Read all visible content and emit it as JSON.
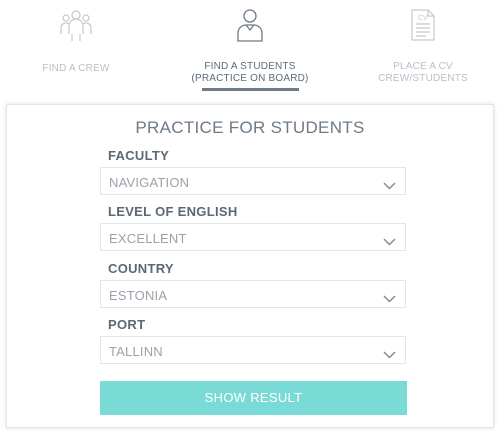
{
  "tabs": [
    {
      "label_line1": "FIND A CREW",
      "label_line2": "",
      "icon": "crew-group-icon",
      "active": false
    },
    {
      "label_line1": "FIND A STUDENTS",
      "label_line2": "(PRACTICE ON BOARD)",
      "icon": "student-person-icon",
      "active": true
    },
    {
      "label_line1": "PLACE A CV",
      "label_line2": "CREW/STUDENTS",
      "icon": "cv-document-icon",
      "active": false
    }
  ],
  "cv_icon_text": "CV",
  "form": {
    "title": "PRACTICE FOR STUDENTS",
    "fields": [
      {
        "label": "FACULTY",
        "value": "NAVIGATION"
      },
      {
        "label": "LEVEL OF ENGLISH",
        "value": "EXCELLENT"
      },
      {
        "label": "COUNTRY",
        "value": "ESTONIA"
      },
      {
        "label": "PORT",
        "value": "TALLINN"
      }
    ],
    "submit_label": "SHOW RESULT"
  },
  "colors": {
    "accent_button": "#7adbd6",
    "active_text": "#5e6b78",
    "inactive_text": "#b9c0c8"
  }
}
